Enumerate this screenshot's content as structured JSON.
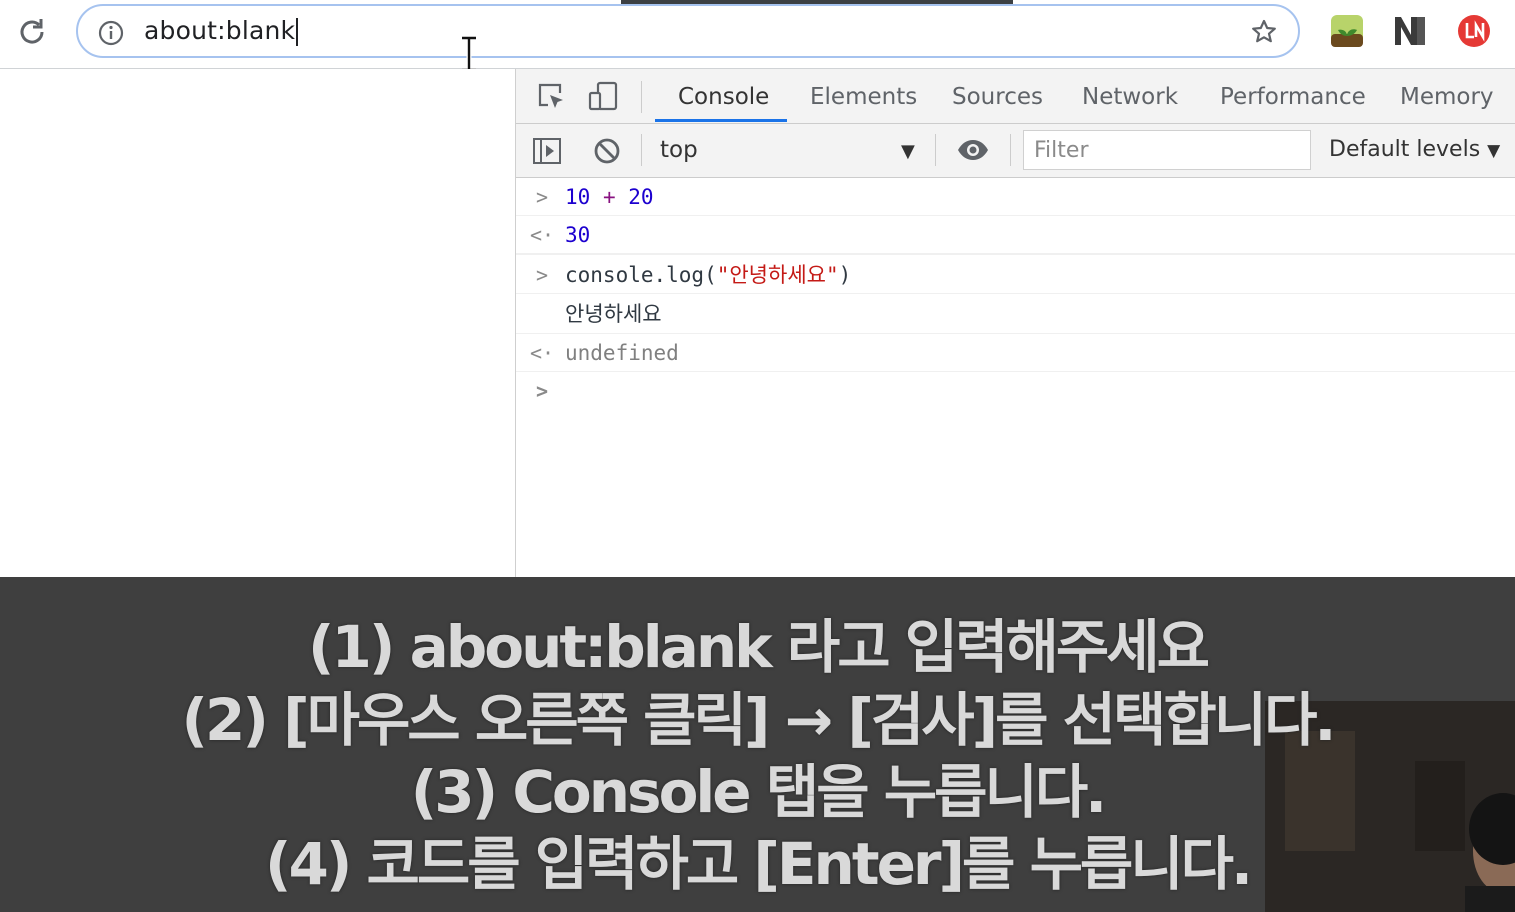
{
  "browser": {
    "url": "about:blank",
    "icons": {
      "reload": "reload-icon",
      "info": "info-icon",
      "bookmark": "star-icon",
      "extension_1": "plant-extension-icon",
      "extension_2": "n-extension-icon",
      "extension_3": "red-extension-icon"
    }
  },
  "devtools": {
    "tabs": [
      "Console",
      "Elements",
      "Sources",
      "Network",
      "Performance",
      "Memory"
    ],
    "active_tab": "Console",
    "context": "top",
    "filter_placeholder": "Filter",
    "levels_label": "Default levels",
    "accent_color": "#1a73e8"
  },
  "console": {
    "lines": [
      {
        "type": "input",
        "tokens": [
          "10",
          "+",
          "20"
        ]
      },
      {
        "type": "result",
        "text": "30"
      },
      {
        "type": "input",
        "code_prefix": "console.log(",
        "string": "\"안녕하세요\"",
        "code_suffix": ")"
      },
      {
        "type": "log",
        "text": "안녕하세요"
      },
      {
        "type": "result",
        "text": "undefined"
      }
    ]
  },
  "caption": {
    "lines": [
      "(1) about:blank 라고 입력해주세요",
      "(2)  [마우스 오른쪽 클릭] → [검사]를 선택합니다.",
      "(3) Console 탭을 누릅니다.",
      "(4) 코드를 입력하고  [Enter]를 누릅니다."
    ]
  }
}
